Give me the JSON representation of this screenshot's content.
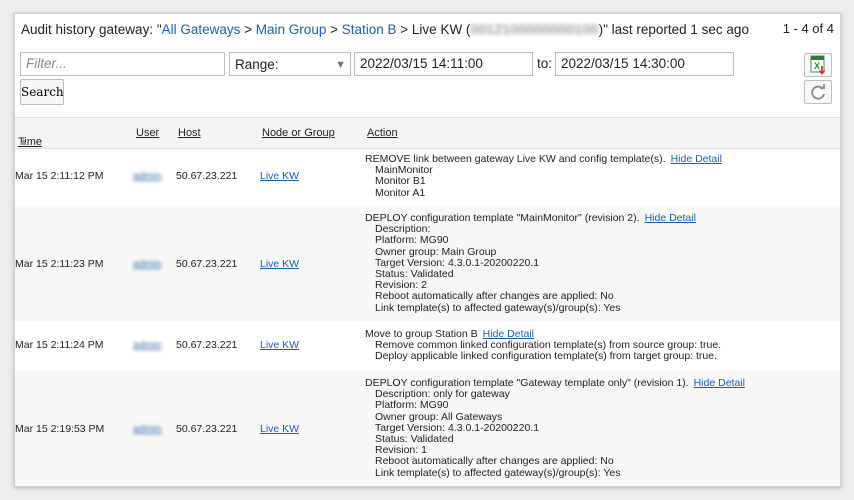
{
  "header": {
    "prefix": "Audit history gateway: \"",
    "crumb_all": "All Gateways",
    "sep1": " > ",
    "crumb_group": "Main Group",
    "sep2": " > ",
    "crumb_station": "Station B",
    "sep3": " > ",
    "current": "Live KW (",
    "serial_redacted": "0012100000000100",
    "suffix": ")\" last reported 1 sec ago"
  },
  "pager": "1 - 4 of 4",
  "filters": {
    "filter_placeholder": "Filter...",
    "range_label": "Range:",
    "from_value": "2022/03/15 14:11:00",
    "to_label": "to:",
    "to_value": "2022/03/15 14:30:00",
    "search_label": "Search"
  },
  "icons": {
    "excel": "excel-export-icon",
    "refresh": "refresh-icon"
  },
  "columns": {
    "time": "Time",
    "sort_indicator": "▲",
    "user": "User",
    "host": "Host",
    "node": "Node or Group",
    "action": "Action"
  },
  "rows": [
    {
      "time": "Mar 15 2:11:12 PM",
      "user": "admin",
      "host": "50.67.23.221",
      "node": "Live KW",
      "action_title": "REMOVE link between gateway Live KW and config template(s).",
      "hide_detail": "Hide Detail",
      "details": [
        "MainMonitor",
        "Monitor B1",
        "Monitor A1"
      ]
    },
    {
      "time": "Mar 15 2:11:23 PM",
      "user": "admin",
      "host": "50.67.23.221",
      "node": "Live KW",
      "action_title": "DEPLOY configuration template \"MainMonitor\" (revision 2).",
      "hide_detail": "Hide Detail",
      "details": [
        "Description:",
        "Platform: MG90",
        "Owner group: Main Group",
        "Target Version: 4.3.0.1-20200220.1",
        "Status: Validated",
        "Revision: 2",
        "Reboot automatically after changes are applied: No",
        "Link template(s) to affected gateway(s)/group(s): Yes"
      ]
    },
    {
      "time": "Mar 15 2:11:24 PM",
      "user": "admin",
      "host": "50.67.23.221",
      "node": "Live KW",
      "action_title": "Move to group Station B",
      "hide_detail": "Hide Detail",
      "details": [
        "Remove common linked configuration template(s) from source group: true.",
        "Deploy applicable linked configuration template(s) from target group: true."
      ]
    },
    {
      "time": "Mar 15 2:19:53 PM",
      "user": "admin",
      "host": "50.67.23.221",
      "node": "Live KW",
      "action_title": "DEPLOY configuration template \"Gateway template only\" (revision 1).",
      "hide_detail": "Hide Detail",
      "details": [
        "Description: only for gateway",
        "Platform: MG90",
        "Owner group: All Gateways",
        "Target Version: 4.3.0.1-20200220.1",
        "Status: Validated",
        "Revision: 1",
        "Reboot automatically after changes are applied: No",
        "Link template(s) to affected gateway(s)/group(s): Yes"
      ]
    }
  ]
}
